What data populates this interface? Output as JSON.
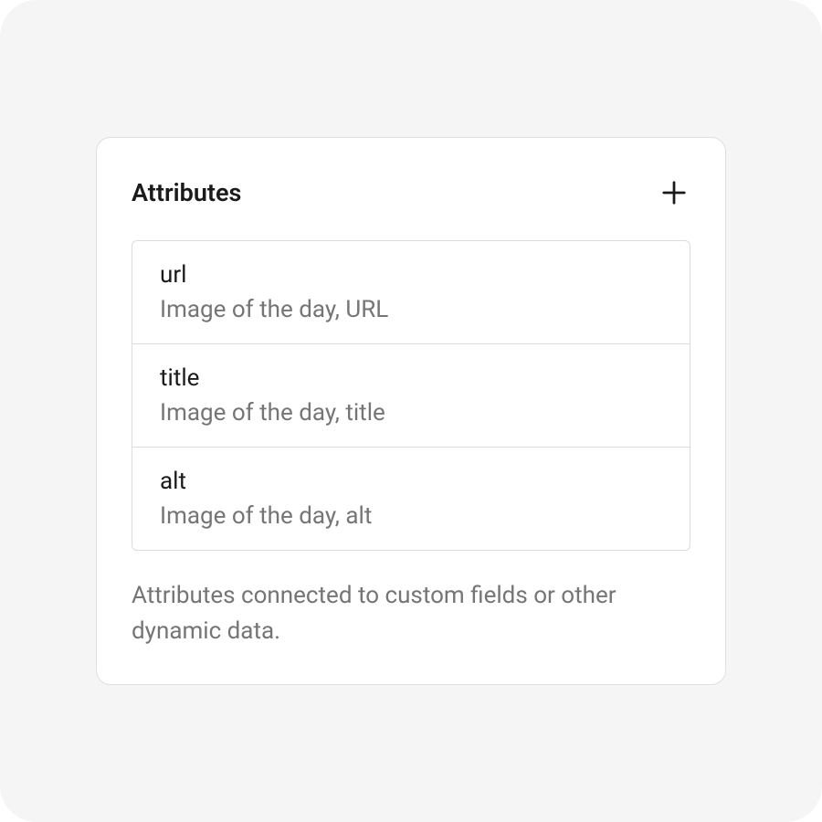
{
  "panel": {
    "title": "Attributes",
    "footer_text": "Attributes connected to custom fields or other dynamic data.",
    "items": [
      {
        "name": "url",
        "description": "Image of the day, URL"
      },
      {
        "name": "title",
        "description": "Image of the day, title"
      },
      {
        "name": "alt",
        "description": "Image of the day, alt"
      }
    ]
  }
}
